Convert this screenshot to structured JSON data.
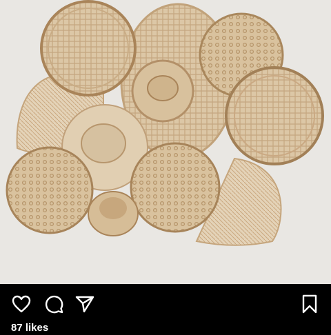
{
  "post": {
    "image": {
      "subject": "woven-baskets-wall"
    },
    "actions": {
      "like_icon": "heart-icon",
      "comment_icon": "comment-icon",
      "share_icon": "send-icon",
      "save_icon": "bookmark-icon"
    },
    "likes_text": "87 likes"
  },
  "colors": {
    "background": "#000000",
    "wall": "#e9e7e3",
    "straw": "#d9c3a1",
    "straw_dark": "#b99b73",
    "icon": "#ffffff"
  }
}
